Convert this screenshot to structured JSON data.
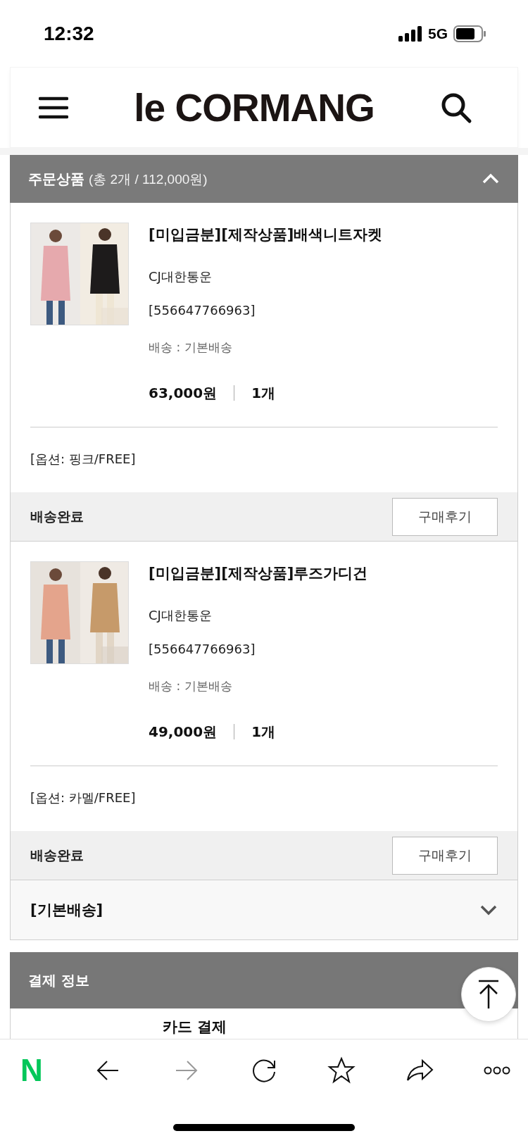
{
  "status_bar": {
    "time": "12:32",
    "network": "5G"
  },
  "header": {
    "logo": "le CORMANG"
  },
  "order_section": {
    "title": "주문상품",
    "summary": "(총 2개 / 112,000원)",
    "expanded": true
  },
  "items": [
    {
      "name": "[미입금분][제작상품]배색니트자켓",
      "carrier": "CJ대한통운",
      "tracking": "[556647766963]",
      "shipping": "배송 : 기본배송",
      "price": "63,000원",
      "quantity": "1개",
      "option": "[옵션: 핑크/FREE]",
      "status": "배송완료",
      "review_button": "구매후기"
    },
    {
      "name": "[미입금분][제작상품]루즈가디건",
      "carrier": "CJ대한통운",
      "tracking": "[556647766963]",
      "shipping": "배송 : 기본배송",
      "price": "49,000원",
      "quantity": "1개",
      "option": "[옵션: 카멜/FREE]",
      "status": "배송완료",
      "review_button": "구매후기"
    }
  ],
  "shipping_group": {
    "label": "[기본배송]",
    "expanded": false
  },
  "payment_section": {
    "title": "결제 정보",
    "method": "카드 결제"
  },
  "toolbar": {
    "brand": "N",
    "buttons": [
      {
        "kind": "back",
        "disabled": false
      },
      {
        "kind": "forward",
        "disabled": true
      },
      {
        "kind": "reload",
        "disabled": false
      },
      {
        "kind": "bookmark",
        "disabled": false
      },
      {
        "kind": "share",
        "disabled": false
      },
      {
        "kind": "more",
        "disabled": false
      }
    ]
  }
}
